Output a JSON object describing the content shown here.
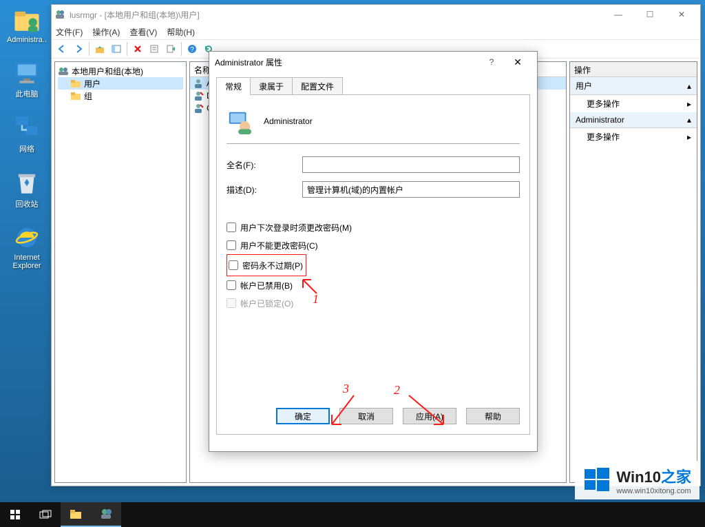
{
  "desktop": {
    "icons": [
      {
        "label": "Administra..",
        "icon": "user"
      },
      {
        "label": "此电脑",
        "icon": "pc"
      },
      {
        "label": "网络",
        "icon": "network"
      },
      {
        "label": "回收站",
        "icon": "recycle"
      },
      {
        "label": "Internet Explorer",
        "icon": "ie"
      }
    ]
  },
  "mmc": {
    "title": "lusrmgr - [本地用户和组(本地)\\用户]",
    "menus": [
      "文件(F)",
      "操作(A)",
      "查看(V)",
      "帮助(H)"
    ],
    "tree": {
      "root": "本地用户和组(本地)",
      "children": [
        "用户",
        "组"
      ]
    },
    "list": {
      "cols": [
        "名称"
      ],
      "rows": [
        "A",
        "D",
        "G"
      ]
    },
    "actions": {
      "header": "操作",
      "panels": [
        {
          "title": "用户",
          "items": [
            "更多操作"
          ]
        },
        {
          "title": "Administrator",
          "items": [
            "更多操作"
          ]
        }
      ]
    }
  },
  "dialog": {
    "title": "Administrator 属性",
    "tabs": [
      "常规",
      "隶属于",
      "配置文件"
    ],
    "username": "Administrator",
    "fields": {
      "fullname_label": "全名(F):",
      "fullname_value": "",
      "desc_label": "描述(D):",
      "desc_value": "管理计算机(域)的内置帐户"
    },
    "checks": {
      "must_change": "用户下次登录时须更改密码(M)",
      "cant_change": "用户不能更改密码(C)",
      "never_exp": "密码永不过期(P)",
      "disabled": "帐户已禁用(B)",
      "locked": "帐户已锁定(O)"
    },
    "buttons": {
      "ok": "确定",
      "cancel": "取消",
      "apply": "应用(A)",
      "help": "帮助"
    }
  },
  "annotations": {
    "a1": "1",
    "a2": "2",
    "a3": "3"
  },
  "watermark": {
    "brand_a": "Win10",
    "brand_b": "之家",
    "url": "www.win10xitong.com"
  },
  "colors": {
    "accent": "#0078d7",
    "red": "#ff1a1a"
  }
}
